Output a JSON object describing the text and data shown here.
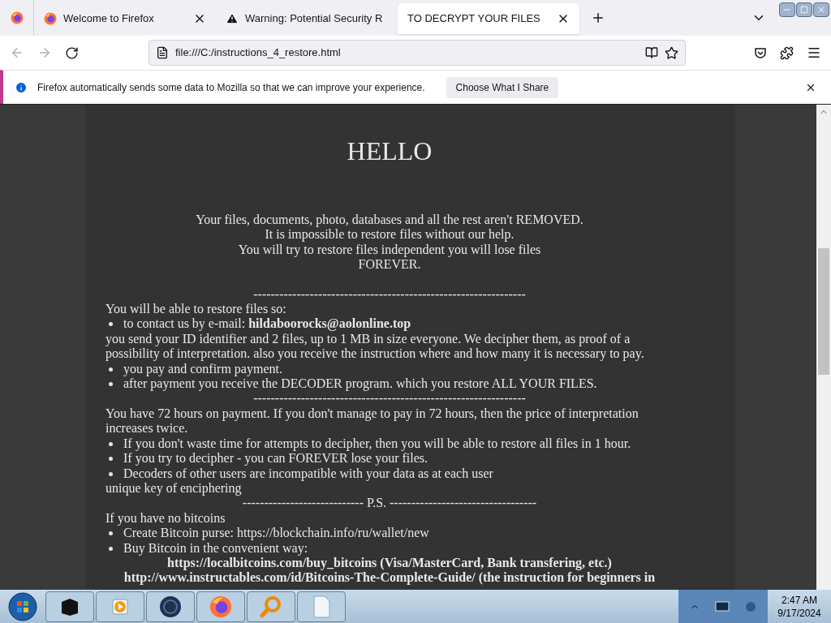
{
  "tabs": [
    {
      "kind": "pinned",
      "selected": false
    },
    {
      "kind": "firefox",
      "title": "Welcome to Firefox",
      "selected": false
    },
    {
      "kind": "warning",
      "title": "Warning: Potential Security R",
      "selected": false
    },
    {
      "kind": "plain",
      "title": "TO DECRYPT YOUR FILES",
      "selected": true
    }
  ],
  "address": "file:///C:/instructions_4_restore.html",
  "notification": {
    "text": "Firefox automatically sends some data to Mozilla so that we can improve your experience.",
    "button": "Choose What I Share"
  },
  "page": [
    {
      "kind": "heading",
      "text": "HELLO"
    },
    {
      "kind": "center",
      "text": "Your files, documents, photo, databases and all the rest aren't REMOVED."
    },
    {
      "kind": "center",
      "text": "It is impossible to restore files without our help."
    },
    {
      "kind": "center",
      "text": "You will try to restore files independent you will lose files"
    },
    {
      "kind": "center",
      "text": "FOREVER."
    },
    {
      "kind": "rule",
      "text": "---------------------------------------------------------------"
    },
    {
      "kind": "text",
      "text": "You will be able to restore files so:"
    },
    {
      "kind": "bullet",
      "text": "to contact us by e-mail: **hildaboorocks@aolonline.top**"
    },
    {
      "kind": "text",
      "text": "you send your ID identifier and 2 files, up to 1 MB in size everyone. We decipher them, as proof of a possibility of interpretation. also you receive the instruction where and how many it is necessary to pay."
    },
    {
      "kind": "bullet",
      "text": "you pay and confirm payment."
    },
    {
      "kind": "bullet",
      "text": "after payment you receive the DECODER program. which you restore ALL YOUR FILES."
    },
    {
      "kind": "rule",
      "text": "---------------------------------------------------------------"
    },
    {
      "kind": "text",
      "text": "You have 72 hours on payment. If you don't manage to pay in 72 hours, then the price of interpretation increases twice."
    },
    {
      "kind": "bullet",
      "text": "If you don't waste time for attempts to decipher, then you will be able to restore all files in 1 hour."
    },
    {
      "kind": "bullet",
      "text": "If you try to decipher - you can FOREVER lose your files."
    },
    {
      "kind": "bullet",
      "text": "Decoders of other users are incompatible with your data as at each user"
    },
    {
      "kind": "text",
      "text": "unique key of enciphering"
    },
    {
      "kind": "rule",
      "text": "---------------------------- P.S. ----------------------------------"
    },
    {
      "kind": "text",
      "text": "If you have no bitcoins"
    },
    {
      "kind": "bullet",
      "text": "Create Bitcoin purse: https://blockchain.info/ru/wallet/new"
    },
    {
      "kind": "bullet",
      "text": "Buy Bitcoin in the convenient way:"
    },
    {
      "kind": "boldcenter",
      "text": "https://localbitcoins.com/buy_bitcoins (Visa/MasterCard, Bank transfering, etc.)"
    },
    {
      "kind": "boldcenter",
      "text": "http://www.instructables.com/id/Bitcoins-The-Complete-Guide/ (the instruction for beginners in"
    }
  ],
  "taskbar": {
    "items": [
      {
        "kind": "box"
      },
      {
        "kind": "media"
      },
      {
        "kind": "globe"
      },
      {
        "kind": "firefox"
      },
      {
        "kind": "magnifier"
      },
      {
        "kind": "document"
      }
    ],
    "time": "2:47 AM",
    "date": "9/17/2024"
  }
}
